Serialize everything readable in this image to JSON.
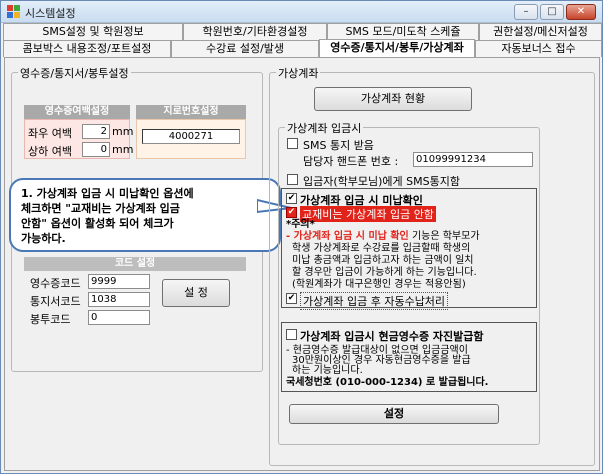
{
  "window": {
    "title": "시스템설정",
    "min_glyph": "–",
    "max_glyph": "□",
    "close_glyph": "✕"
  },
  "tabs_top": [
    "SMS설정 및 학원정보",
    "학원번호/기타환경설정",
    "SMS 모드/미도착 스케쥴",
    "권한설정/메신저설정"
  ],
  "tabs_bottom": [
    "콤보박스 내용조정/포트설정",
    "수강료 설정/발생",
    "영수증/통지서/봉투/가상계좌",
    "자동보너스 접수"
  ],
  "left": {
    "group_label": "영수증/통지서/봉투설정",
    "margin_header": "영수증여백설정",
    "left_margin_label": "좌우 여백",
    "left_margin_value": "2",
    "unit": "mm",
    "top_margin_label": "상하 여백",
    "top_margin_value": "0",
    "giro_header": "지로번호설정",
    "giro_value": "4000271",
    "code_header": "코드 설정",
    "receipt_code_label": "영수증코드",
    "receipt_code_value": "9999",
    "notice_code_label": "통지서코드",
    "notice_code_value": "1038",
    "envelope_code_label": "봉투코드",
    "envelope_code_value": "0",
    "set_button": "설 정"
  },
  "callout": {
    "text1": "1. 가상계좌 입금 시 미납확인 옵션에",
    "text2": "체크하면 \"교재비는 가상계좌 입금",
    "text3": "안함\" 옵션이 활성화 되어 체크가",
    "text4": "가능하다."
  },
  "right": {
    "group_label": "가상계좌",
    "status_button": "가상계좌 현황",
    "deposit_group_label": "가상계좌 입금시",
    "sms_receive_label": "SMS 통지 받음",
    "phone_label": "담당자 핸드폰 번호 :",
    "phone_value": "01099991234",
    "parent_sms_label": "입금자(학부모님)에게 SMS통지함",
    "unpaid_check_label": "가상계좌 입금 시 미납확인",
    "textbook_label": "교재비는 가상계좌 입금 안함",
    "note_title": "*주의*",
    "note_highlight": "- 가상계좌 입금 시 미납 확인",
    "note_rest1": " 기능은 학부모가",
    "note_line2": "학생 가상계좌로 수강료를 입금할때  학생의",
    "note_line3": "미납 총금액과 입금하고자 하는 금액이 일치",
    "note_line4": "할 경우만 입금이 가능하게 하는 기능입니다.",
    "note_line5": "(학원계좌가 대구은행인 경우는 적용안됨)",
    "auto_receipt_label": "가상계좌 입금 후  자동수납처리",
    "cash_receipt_label": "가상계좌 입금시 현금영수증 자진발급함",
    "cash_note1": "- 현금영수증 발급대상이 없으면  입금금액이",
    "cash_note2": "30만원이상인 경우 자동현금영수증을 발급",
    "cash_note3": "하는 기능입니다.",
    "cash_note4": "국세청번호 (010-000-1234) 로 발급됩니다.",
    "set_button": "설정"
  },
  "colors": {
    "accent_red": "#e2231a",
    "pink_bg": "#fde7e4",
    "callout_border": "#4a78b5",
    "header_gray": "#a9a9a9",
    "input_peach": "#fff2e6"
  }
}
